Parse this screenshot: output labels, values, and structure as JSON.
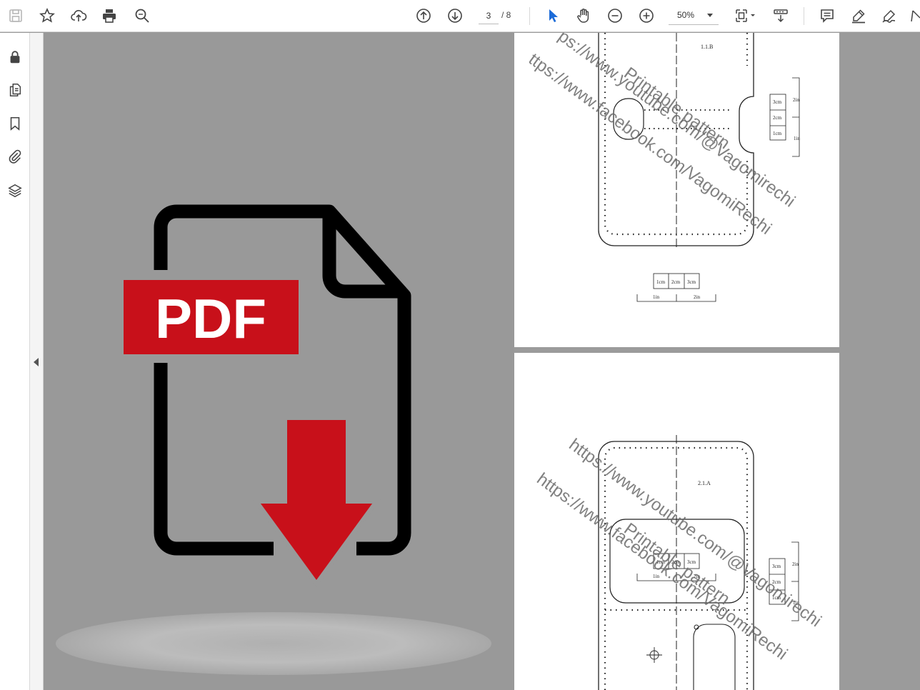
{
  "toolbar": {
    "page_current": "3",
    "page_total": "/ 8",
    "zoom": "50%",
    "icons": [
      "save-icon",
      "bookmark-star-icon",
      "upload-cloud-icon",
      "print-icon",
      "find-icon",
      "previous-page-icon",
      "next-page-icon",
      "select-arrow-icon",
      "hand-tool-icon",
      "zoom-out-icon",
      "zoom-in-icon",
      "page-fit-icon",
      "scroll-mode-icon",
      "comment-icon",
      "highlight-icon",
      "sign-icon"
    ]
  },
  "sidebar": {
    "icons": [
      "lock-icon",
      "pages-icon",
      "bookmark-icon",
      "attachment-icon",
      "layers-icon"
    ]
  },
  "promo": {
    "badge_text": "PDF",
    "accent_color": "#c8101a",
    "outline_color": "#000000"
  },
  "page_a": {
    "label": "1.1.B",
    "watermark_1": "ps://www.youtube.com/@Vagomirechi",
    "watermark_2": "Printable pattern",
    "watermark_3": "ttps://www.facebook.com/VagomiRechi",
    "scale_cm": [
      "1cm",
      "2cm",
      "3cm"
    ],
    "scale_in": [
      "1in",
      "2in"
    ],
    "side_scale_cm": [
      "3cm",
      "2cm",
      "1cm"
    ],
    "side_scale_in": [
      "2in",
      "1in"
    ]
  },
  "page_b": {
    "label": "2.1.A",
    "watermark_1": "https://www.youtube.com/@Vagomirechi",
    "watermark_2": "Printable pattern",
    "watermark_3": "https://www.facebook.com/VagomiRechi",
    "scale_cm": [
      "1cm",
      "2cm",
      "3cm"
    ],
    "scale_in": [
      "1in",
      "2in"
    ],
    "side_scale_cm": [
      "3cm",
      "2cm",
      "1cm"
    ],
    "side_scale_in": [
      "2in",
      "1in"
    ]
  }
}
